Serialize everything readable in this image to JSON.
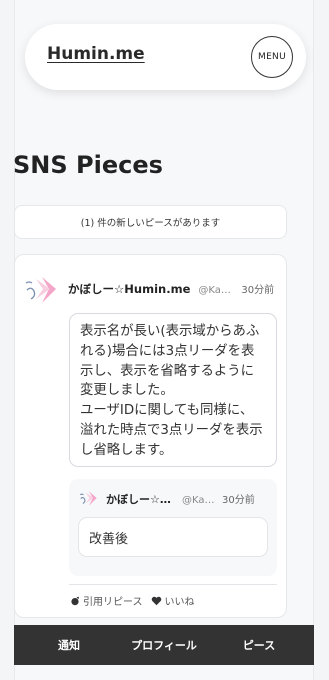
{
  "header": {
    "logo": "Humin.me",
    "menu_label": "MENU"
  },
  "page_title": "SNS Pieces",
  "notice": "(1) 件の新しいピースがあります",
  "post": {
    "display_name": "かぼしー☆Humin.me",
    "user_id": "@Kabocy",
    "time": "30分前",
    "body_lines": [
      "表示名が長い(表示域からあふ",
      "れる)場合には3点リーダを表",
      "示し、表示を省略するように",
      "変更しました。",
      "ユーザIDに関しても同様に、",
      "溢れた時点で3点リーダを表示",
      "し省略します。"
    ],
    "quote": {
      "display_name": "かぼしー☆Humin.me",
      "user_id": "@Kabocy",
      "time": "30分前",
      "text": "改善後"
    },
    "actions": {
      "requote": "引用リピース",
      "like": "いいね"
    }
  },
  "bottom_nav": [
    "通知",
    "プロフィール",
    "ピース"
  ],
  "colors": {
    "accent_pink": "#f3a6c8",
    "nav_bg": "#333333"
  }
}
